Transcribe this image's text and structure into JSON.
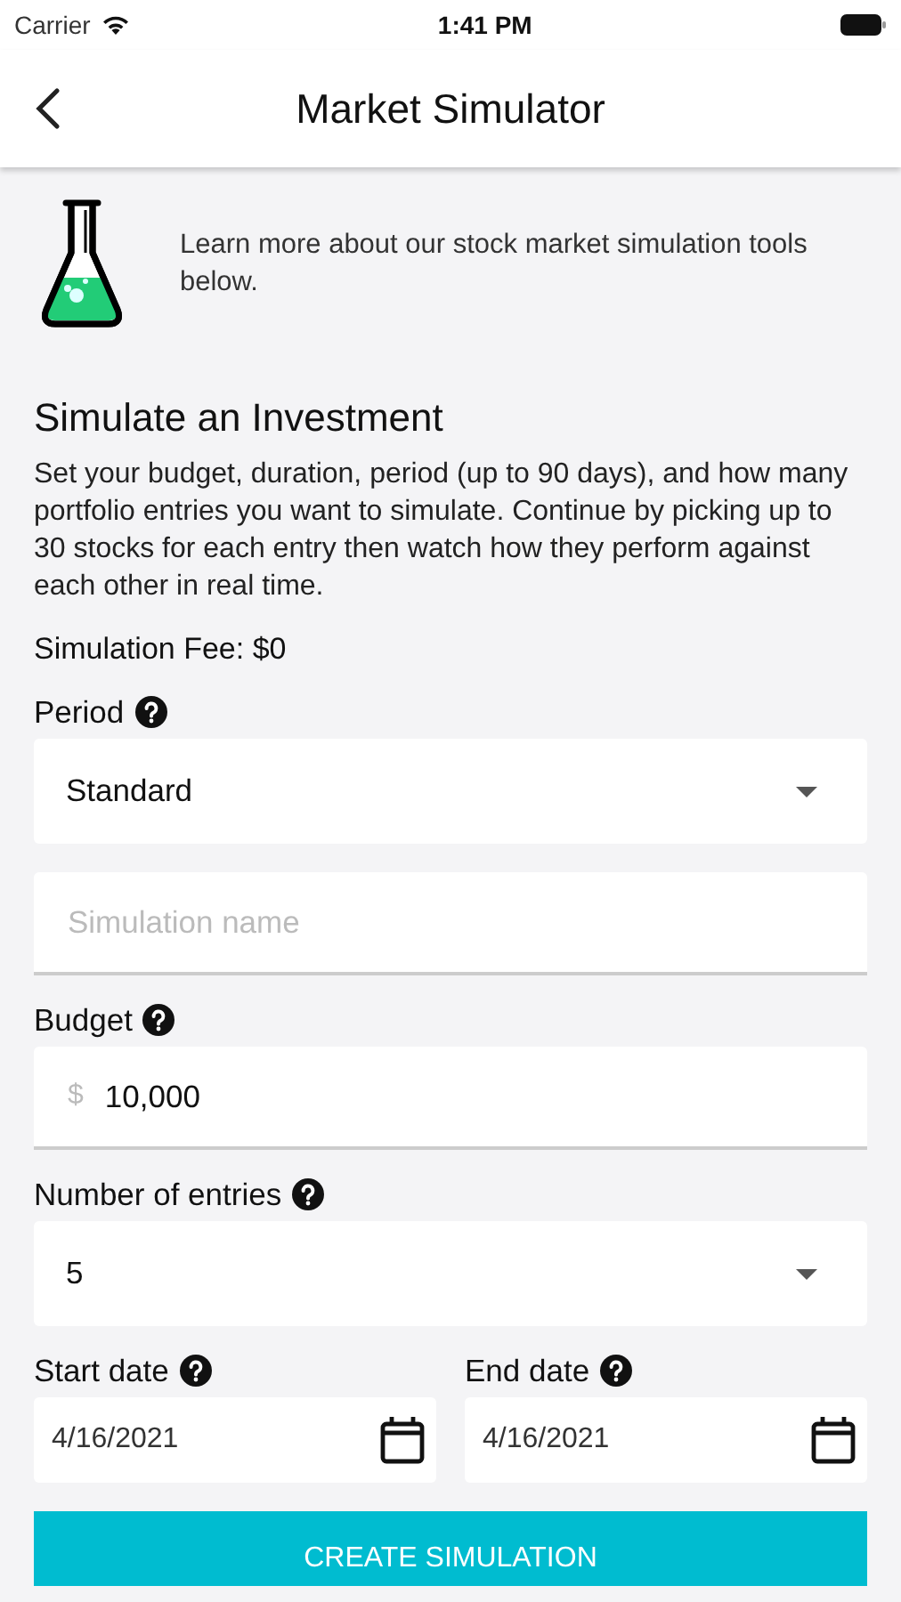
{
  "status_bar": {
    "carrier": "Carrier",
    "time": "1:41 PM"
  },
  "header": {
    "title": "Market Simulator"
  },
  "intro": {
    "text": "Learn more about our stock market simulation tools below."
  },
  "simulation": {
    "heading": "Simulate an Investment",
    "description": "Set your budget, duration, period (up to 90 days), and how many portfolio entries you want to simulate. Continue by picking up to 30 stocks for each entry then watch how they perform against each other in real time.",
    "fee": "Simulation Fee: $0"
  },
  "fields": [
    {
      "kind": "select",
      "label": "Period",
      "help": true,
      "value": "Standard"
    },
    {
      "kind": "text",
      "placeholder": "Simulation name"
    },
    {
      "kind": "currency",
      "label": "Budget",
      "help": true,
      "prefix": "$",
      "value": "10,000"
    },
    {
      "kind": "select",
      "label": "Number of entries",
      "help": true,
      "value": "5"
    }
  ],
  "dates": [
    {
      "label": "Start date",
      "help": true,
      "value": "4/16/2021"
    },
    {
      "label": "End date",
      "help": true,
      "value": "4/16/2021"
    }
  ],
  "submit": {
    "label": "CREATE SIMULATION"
  }
}
